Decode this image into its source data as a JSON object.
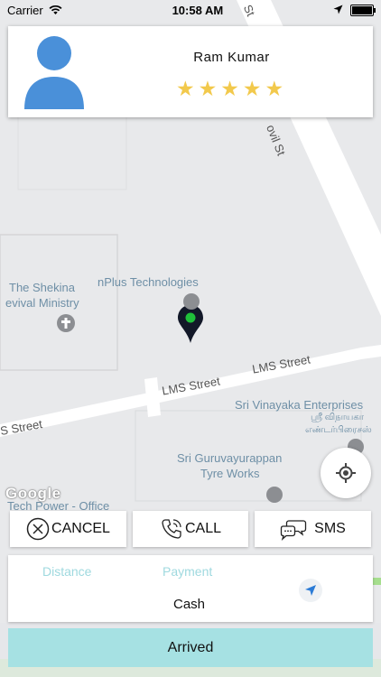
{
  "status_bar": {
    "carrier": "Carrier",
    "time": "10:58 AM"
  },
  "driver": {
    "name": "Ram Kumar",
    "rating": 5,
    "rating_max": 5
  },
  "map": {
    "labels": {
      "street_top_a": "St",
      "street_top_b": "ovil St",
      "ministry_line1": "The Shekina",
      "ministry_line2": "evival Ministry",
      "tech": "nPlus Technologies",
      "lms_1": "LMS Street",
      "lms_2": "LMS Street",
      "lms_3": "S Street",
      "vinayaka": "Sri Vinayaka Enterprises",
      "tamil_1": "ஸ்ரீ விநாயகா",
      "tamil_2": "எண்டர்பிரைசஸ்",
      "guru_1": "Sri Guruvayurappan",
      "guru_2": "Tyre Works",
      "power": "Tech Power - Office",
      "google": "Google"
    }
  },
  "actions": {
    "cancel": "CANCEL",
    "call": "CALL",
    "sms": "SMS"
  },
  "info": {
    "distance_label": "Distance",
    "payment_label": "Payment",
    "payment_value": "Cash"
  },
  "arrived_label": "Arrived",
  "colors": {
    "accent": "#a6e1e3",
    "label": "#9fd9df",
    "star": "#f2c94c",
    "pin_dot": "#1fbf3a"
  }
}
